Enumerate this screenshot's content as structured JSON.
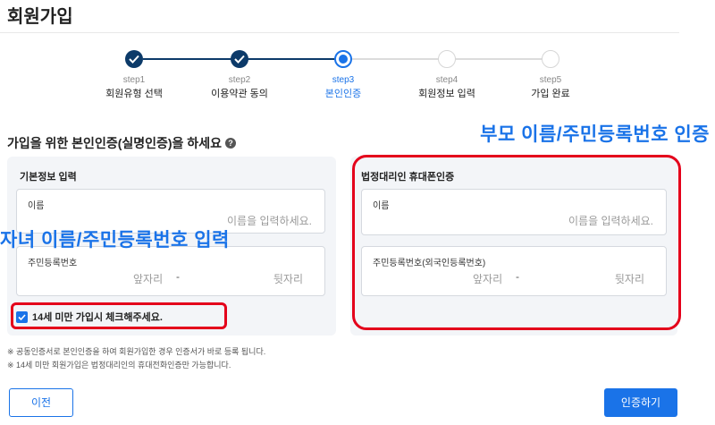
{
  "page": {
    "title": "회원가입"
  },
  "stepper": {
    "steps": [
      {
        "num": "step1",
        "name": "회원유형 선택",
        "state": "done"
      },
      {
        "num": "step2",
        "name": "이용약관 동의",
        "state": "done"
      },
      {
        "num": "step3",
        "name": "본인인증",
        "state": "active"
      },
      {
        "num": "step4",
        "name": "회원정보 입력",
        "state": "pending"
      },
      {
        "num": "step5",
        "name": "가입 완료",
        "state": "pending"
      }
    ]
  },
  "section": {
    "title": "가입을 위한 본인인증(실명인증)을 하세요",
    "help_glyph": "?"
  },
  "basic_info": {
    "heading": "기본정보 입력",
    "name_label": "이름",
    "name_placeholder": "이름을 입력하세요.",
    "ssn_label": "주민등록번호",
    "ssn_front": "앞자리",
    "ssn_dash": "-",
    "ssn_back": "뒷자리"
  },
  "under14": {
    "label": "14세 미만 가입시 체크해주세요.",
    "checked": true
  },
  "guardian": {
    "heading": "법정대리인 휴대폰인증",
    "name_label": "이름",
    "name_placeholder": "이름을 입력하세요.",
    "ssn_label": "주민등록번호(외국인등록번호)",
    "ssn_front": "앞자리",
    "ssn_dash": "-",
    "ssn_back": "뒷자리"
  },
  "annotations": {
    "parent_callout": "부모 이름/주민등록번호 인증",
    "child_callout": "자녀 이름/주민등록번호 입력",
    "highlight_color": "#e4001b",
    "callout_color": "#1a73e8"
  },
  "notes": [
    "※ 공동인증서로 본인인증을 하여 회원가입한 경우 인증서가 바로 등록 됩니다.",
    "※ 14세 미만 회원가입은 법정대리인의 휴대전화인증만 가능합니다."
  ],
  "buttons": {
    "prev": "이전",
    "verify": "인증하기"
  },
  "colors": {
    "done_step": "#0c3a69",
    "accent": "#1a73e8",
    "panel_bg": "#f3f5f8"
  }
}
